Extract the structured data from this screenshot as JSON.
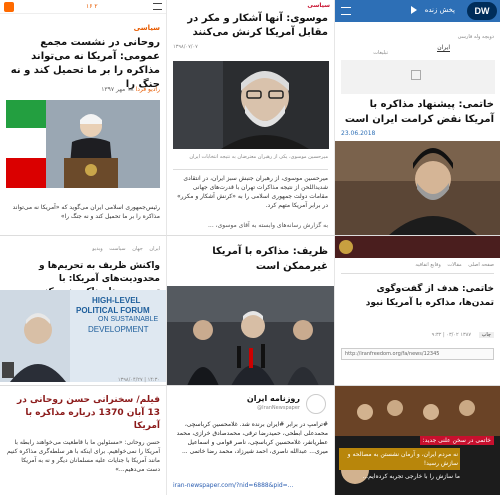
{
  "colors": {
    "dw_blue": "#2d6fb6",
    "dw_logo_bg": "#002d5a",
    "accent_red": "#c8102e",
    "orange": "#ff6a00",
    "gray_bg": "#f2f2f2"
  },
  "p1": {
    "top_icons": "۱۶ ۲",
    "section": "سیاسی",
    "headline": "روحانی در نشست مجمع عمومی: آمریکا نه می‌تواند مذاکره را بر ما تحمیل کند و نه جنگ را",
    "source": "رادیو فردا",
    "date": "۱۸ مهر ۱۳۹۷",
    "lead": "رئیس‌جمهوری اسلامی ایران می‌گوید که «آمریکا نه می‌تواند مذاکره را بر ما تحمیل کند و نه جنگ را»"
  },
  "p2": {
    "section": "سیاسی",
    "headline": "موسوی: آنها آشکار و مکر در مقابل آمریکا کرنش می‌کنند",
    "date": "۱۳۹۸/۰۷/۰۷",
    "caption": "میرحسین موسوی، یکی از رهبران معترضان به نتیجه انتخابات ایران",
    "body": "میرحسین موسوی، از رهبران جنبش سبز ایران، در انتقادی شدیداللحن از نتیجه مذاکرات تهران با قدرت‌های جهانی مقامات دولت جمهوری اسلامی را به «کرنش آشکار و مکرر» در برابر آمریکا متهم کرد.",
    "more": "به گزارش رسانه‌های وابسته به آقای موسوی، ..."
  },
  "p3": {
    "live": "پخش زنده",
    "logo": "DW",
    "nav": "دویچه وله فارسی",
    "tab_iran": "ایران",
    "tab_ads": "تبلیغات",
    "headline": "خاتمی: پیشنهاد مذاکره با آمریکا نقض کرامت ایران است",
    "date": "23.06.2018"
  },
  "p4": {
    "tabs": [
      "ایران",
      "جهان",
      "سیاست",
      "ویدیو"
    ],
    "headline": "واکنش ظریف به تحریم‌ها و محدودیت‌های آمریکا: با تروریست‌ها مذاکره نمی‌کنیم",
    "banner_1": "HIGH-LEVEL",
    "banner_2": "POLITICAL FORUM",
    "banner_3": "ON SUSTAINABLE",
    "banner_4": "DEVELOPMENT",
    "meta": "۱۴:۳۰ | ۱۳۹۸/۰۴/۲۷"
  },
  "p5": {
    "headline": "ظریف: مذاکره با آمریکا غیرممکن است"
  },
  "p6": {
    "tabs": [
      "صفحه اصلی",
      "مقالات",
      "وقایع اتفاقیه"
    ],
    "headline": "خاتمی: هدف از گفت‌وگوی تمدن‌ها، مذاکره با آمریکا نبود",
    "meta": "۱۳۸۷ ۰۳/۰۲ | ۹:۳۲",
    "print": "چاپ",
    "url": "http://iranfreedom.org/fa/news/12345"
  },
  "p7": {
    "headline": "فیلم/ سخنرانی حسن روحانی در 13 آبان 1370 درباره مذاکره با آمریکا",
    "body": "حسن روحانی: «مسئولین ما با قاطعیت می‌خواهند رابطه با آمریکا را نمی‌خواهیم. برای اینکه با هر سلطه‌گری مذاکره کنیم مانند آمریکا با جنایات علیه مسلمانان دیگر و نه به آمریکا دست می‌دهیم...»"
  },
  "p8": {
    "name": "روزنامه ایران",
    "handle": "@IranNewspaper",
    "body": "#ترامپ در برابر #ایران برنده شد. غلامحسین کرباسچی، محمدعلی ابطحی، حمیدرضا ترقی، محمدصادق خرازی، محمد عطریانفر، غلامحسین کرباسچی، ناصر قوامی و اسماعیل میری... عبدالله ناصری، احمد شیرزاد، محمد رضا خاتمی ...",
    "link": "iran-newspaper.com/?nid=6888&pid=..."
  },
  "p9": {
    "quote_label": "خاتمی در سخن علنی جدید:",
    "quote": "نه مردم ایران، و آرمان نشستن به مصالحه و سازش رسید!",
    "quote2": "ما سازش را با خارجی تجربه کرده‌ایم..."
  }
}
